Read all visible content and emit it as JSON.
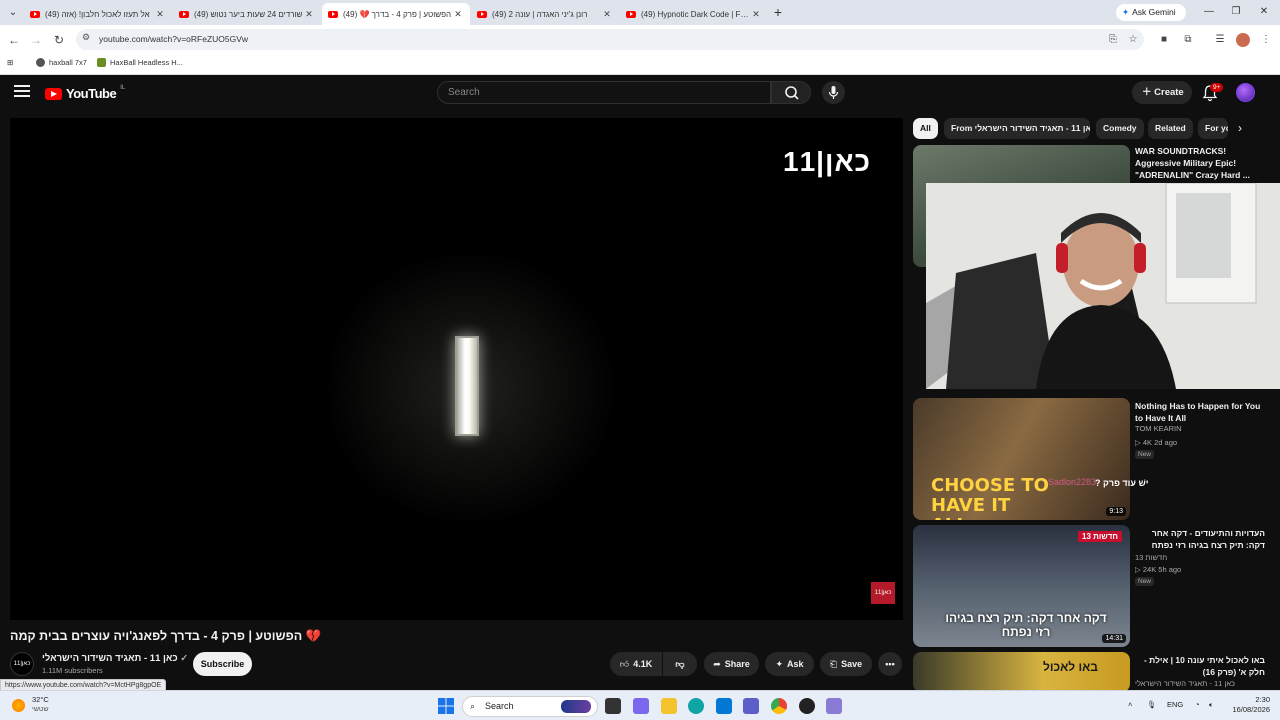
{
  "browser": {
    "tabs": [
      {
        "title": "(49) אל תעזו לאכול חלבון! (אזה",
        "active": false
      },
      {
        "title": "(49) שורדים 24 שעות ביער נטוש",
        "active": false
      },
      {
        "title": "(49) 💔 הפשוטע | פרק 4 - בדרך",
        "active": true
      },
      {
        "title": "(49) רונן ג'יני האגדה | עונה 2",
        "active": false
      },
      {
        "title": "(49) Hypnotic Dark Code | Futu",
        "active": false
      }
    ],
    "new_tab": "+",
    "ask_gemini": "Ask Gemini",
    "url": "youtube.com/watch?v=oRFeZUO5GVw",
    "bookmarks": [
      "haxball 7x7",
      "HaxBall Headless H..."
    ],
    "status_url": "https://www.youtube.com/watch?v=MctHPg8gpOE"
  },
  "youtube": {
    "logo_text": "YouTube",
    "logo_country": "IL",
    "search_placeholder": "Search",
    "create_label": "Create",
    "notif_count": "9+",
    "player": {
      "watermark": "כאן|11",
      "corner_logo": "כאן|11"
    },
    "video": {
      "title": "💔 הפשוטע | פרק 4 - בדרך לפאנג'ויה עוצרים בבית קמה",
      "channel_name": "כאן 11 - תאגיד השידור הישראלי",
      "channel_avatar": "כאן|11",
      "subscribers": "1.11M subscribers",
      "subscribe_label": "Subscribe",
      "likes": "4.1K",
      "share_label": "Share",
      "ask_label": "Ask",
      "save_label": "Save"
    },
    "chips": [
      "All",
      "From כאן 11 - תאגיד השידור הישראלי",
      "Comedy",
      "Related",
      "For you"
    ],
    "recommendations": [
      {
        "title": "WAR SOUNDTRACKS! Aggressive Military Epic! \"ADRENALIN\" Crazy Hard ...",
        "channel": "",
        "meta": "",
        "badge": "",
        "duration": ""
      },
      {
        "title": "Nothing Has to Happen for You to Have It All",
        "channel": "TOM KEARIN",
        "meta": "▷ 4K  2d ago",
        "badge": "New",
        "duration": "9:13",
        "thumb_text": "CHOOSE TO HAVE IT ALL"
      },
      {
        "title": "העדויות והתיעודים - דקה אחר דקה: תיק רצח בגיהו רזי נפתח",
        "channel": "חדשות 13",
        "meta": "▷ 24K  5h ago",
        "badge": "New",
        "duration": "14:31",
        "thumb_text": "דקה אחר דקה: תיק רצח בגיהו רזי נפתח",
        "thumb_tag": "חדשות 13"
      },
      {
        "title": "באו לאכול איתי עונה 10 | אילת - חלק א' (פרק 16)",
        "channel": "כאן 11 - תאגיד השידור הישראלי",
        "meta": "",
        "badge": "",
        "duration": "",
        "thumb_text": "באו לאכול"
      }
    ],
    "overlay_text": "ישׁ עוד פרק ?",
    "overlay_user": "Sadlon2283"
  },
  "taskbar": {
    "weather_temp": "32°C",
    "weather_desc": "שטשי",
    "search_label": "Search",
    "lang": "ENG",
    "time": "2:30",
    "date": "16/08/2026"
  }
}
